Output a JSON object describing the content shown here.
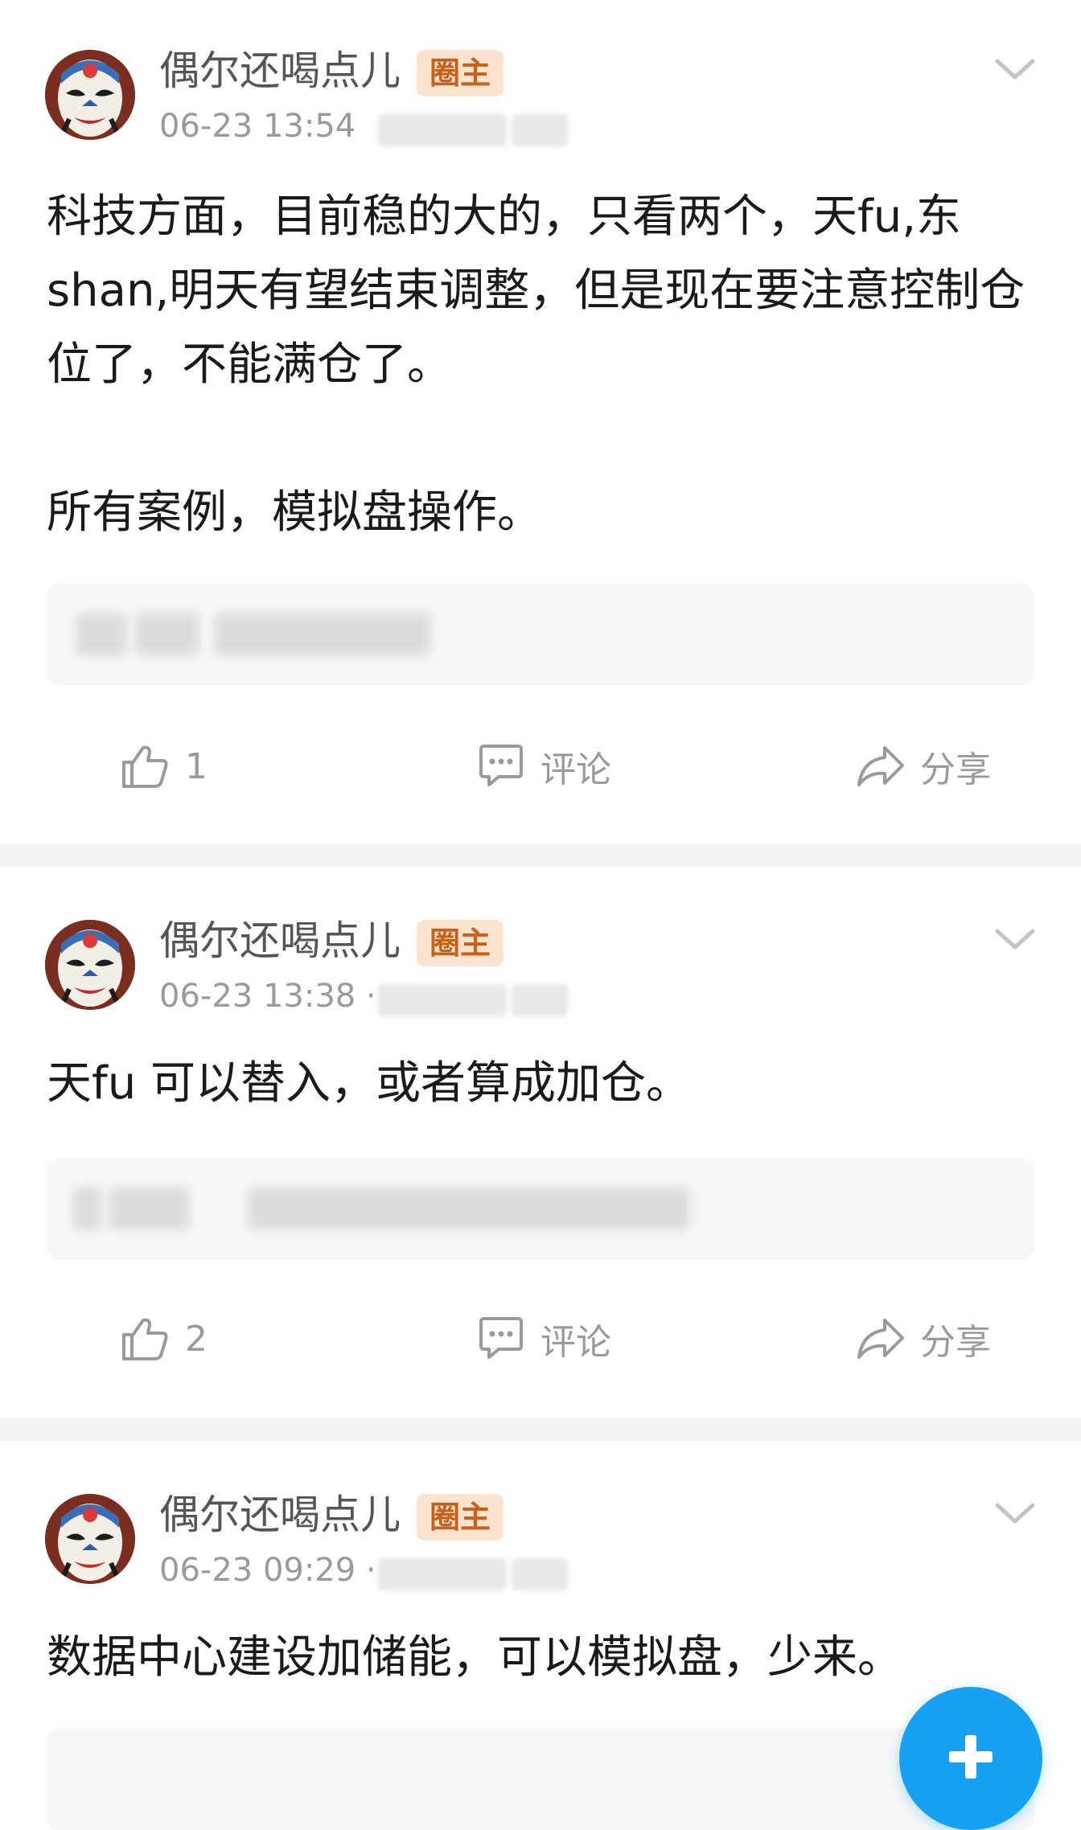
{
  "posts": [
    {
      "author": "偶尔还喝点儿",
      "badge": "圈主",
      "time": "06-23 13:54",
      "content": "科技方面，目前稳的大的，只看两个，天fu,东shan,明天有望结束调整，但是现在要注意控制仓位了，不能满仓了。\n\n所有案例，模拟盘操作。",
      "likes": "1",
      "comment_label": "评论",
      "share_label": "分享"
    },
    {
      "author": "偶尔还喝点儿",
      "badge": "圈主",
      "time": "06-23 13:38 ·",
      "content": "天fu 可以替入，或者算成加仓。",
      "likes": "2",
      "comment_label": "评论",
      "share_label": "分享"
    },
    {
      "author": "偶尔还喝点儿",
      "badge": "圈主",
      "time": "06-23 09:29 ·",
      "content": "数据中心建设加储能，可以模拟盘，少来。"
    }
  ],
  "colors": {
    "accent": "#17a1f3",
    "badge_bg": "#fbe3cd",
    "badge_text": "#c6601a",
    "muted": "#9a9a9a"
  },
  "icons": {
    "like": "thumbs-up-icon",
    "comment": "comment-bubble-icon",
    "share": "share-arrow-icon",
    "more": "chevron-down-icon",
    "compose": "plus-icon"
  }
}
